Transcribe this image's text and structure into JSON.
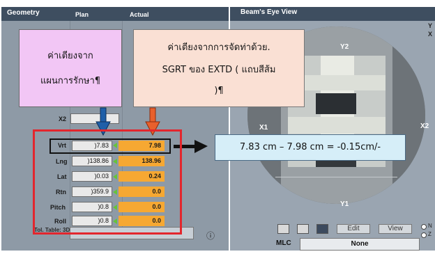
{
  "geometry": {
    "title": "Geometry",
    "plan_header": "Plan",
    "actual_header": "Actual",
    "x2_label": "X2",
    "rows": [
      {
        "label": "Vrt",
        "plan": ")7.83",
        "actual": "7.98"
      },
      {
        "label": "Lng",
        "plan": ")138.86",
        "actual": "138.96"
      },
      {
        "label": "Lat",
        "plan": ")0.03",
        "actual": "0.24"
      },
      {
        "label": "Rtn",
        "plan": ")359.9",
        "actual": "0.0"
      },
      {
        "label": "Pitch",
        "plan": ")0.8",
        "actual": "0.0"
      },
      {
        "label": "Roll",
        "plan": ")0.8",
        "actual": "0.0"
      }
    ],
    "tol_table_label": "Tol. Table: 3DCRT",
    "info_icon_glyph": "ⓘ"
  },
  "bev": {
    "title": "Beam's Eye View",
    "labels": {
      "y2": "Y2",
      "y1": "Y1",
      "x1": "X1",
      "x2": "X2",
      "edge_y": "Y",
      "edge_x": "X"
    },
    "edit_label": "Edit",
    "view_label": "View",
    "mlc_label": "MLC",
    "mlc_value": "None",
    "radio_n": "N",
    "radio_z": "Z"
  },
  "annotations": {
    "plan_callout_line1": "ค่าเตียงจาก",
    "plan_callout_line2": "แผนการรักษา¶",
    "sgrt_callout_line1": "ค่าเตียงจากการจัดท่าด้วย.",
    "sgrt_callout_line2": "SGRT ของ EXTD ( แถบสีส้ม",
    "sgrt_callout_line3": ")¶",
    "calc_text": "7.83 cm – 7.98 cm = -0.15cm/-"
  },
  "colors": {
    "header_bg": "#3e4e60",
    "actual_orange": "#f6a832",
    "highlight_red": "#e3262d",
    "plan_callout_bg": "#f2c6f5",
    "sgrt_callout_bg": "#fae0d4",
    "calc_box_bg": "#d6eef8",
    "arrow_blue": "#1f5fa8",
    "arrow_orange": "#e8602c"
  }
}
